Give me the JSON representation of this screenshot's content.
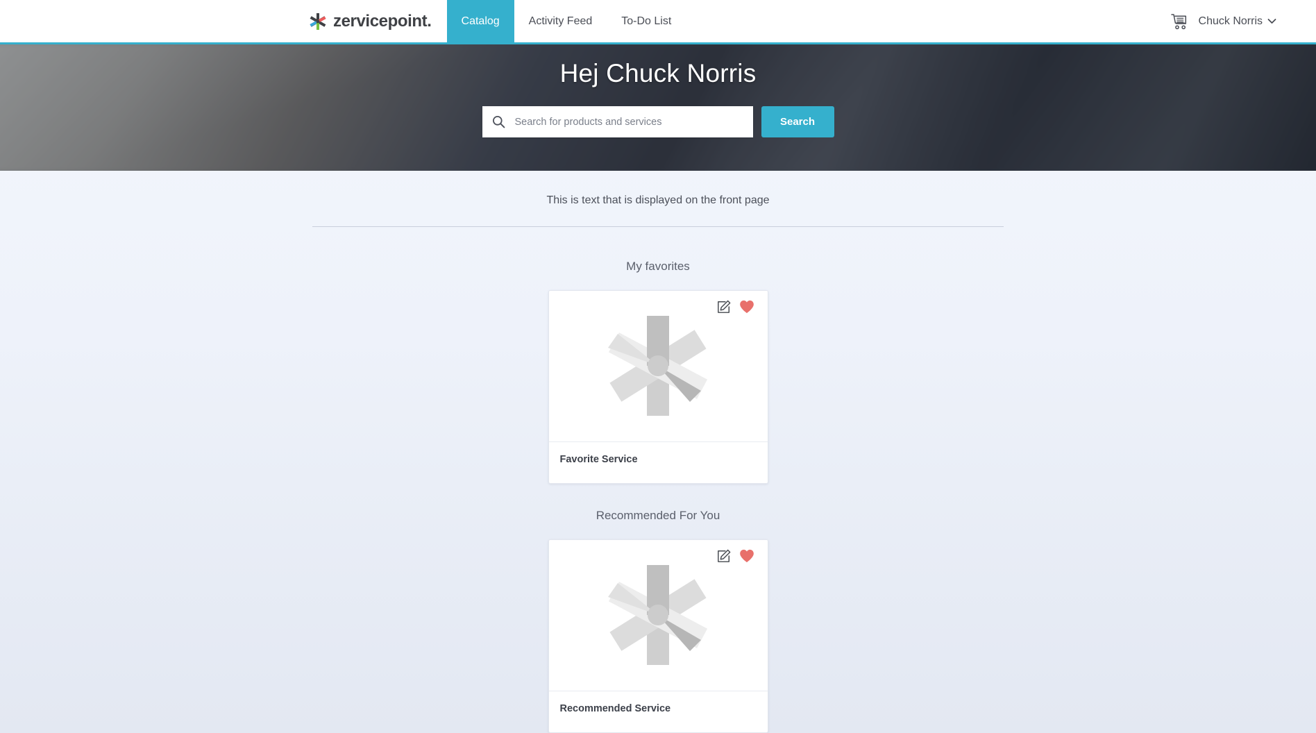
{
  "brand": {
    "name": "zervicepoint.",
    "logo_icon": "zervicepoint-asterisk-logo",
    "colors": {
      "blue": "#3aa7d8",
      "red": "#ee5b5b",
      "green": "#7ac143",
      "dark": "#3f4145"
    }
  },
  "nav": {
    "tabs": [
      {
        "label": "Catalog",
        "active": true
      },
      {
        "label": "Activity Feed",
        "active": false
      },
      {
        "label": "To-Do List",
        "active": false
      }
    ],
    "cart_icon": "shopping-cart-icon",
    "user": {
      "name": "Chuck Norris",
      "chevron_icon": "chevron-down-icon"
    },
    "accent_color": "#35b0cd"
  },
  "hero": {
    "title": "Hej Chuck Norris",
    "search": {
      "placeholder": "Search for products and services",
      "value": "",
      "icon": "search-icon",
      "button_label": "Search"
    }
  },
  "frontpage": {
    "text": "This is text that is displayed on the front page"
  },
  "sections": [
    {
      "title": "My favorites",
      "card": {
        "title": "Favorite Service",
        "image_icon": "service-placeholder-pinwheel-icon",
        "edit_icon": "edit-pencil-icon",
        "favorite_icon": "heart-filled-icon",
        "favorite_color": "#e8706b"
      }
    },
    {
      "title": "Recommended For You",
      "card": {
        "title": "Recommended Service",
        "image_icon": "service-placeholder-pinwheel-icon",
        "edit_icon": "edit-pencil-icon",
        "favorite_icon": "heart-filled-icon",
        "favorite_color": "#e8706b"
      }
    }
  ]
}
